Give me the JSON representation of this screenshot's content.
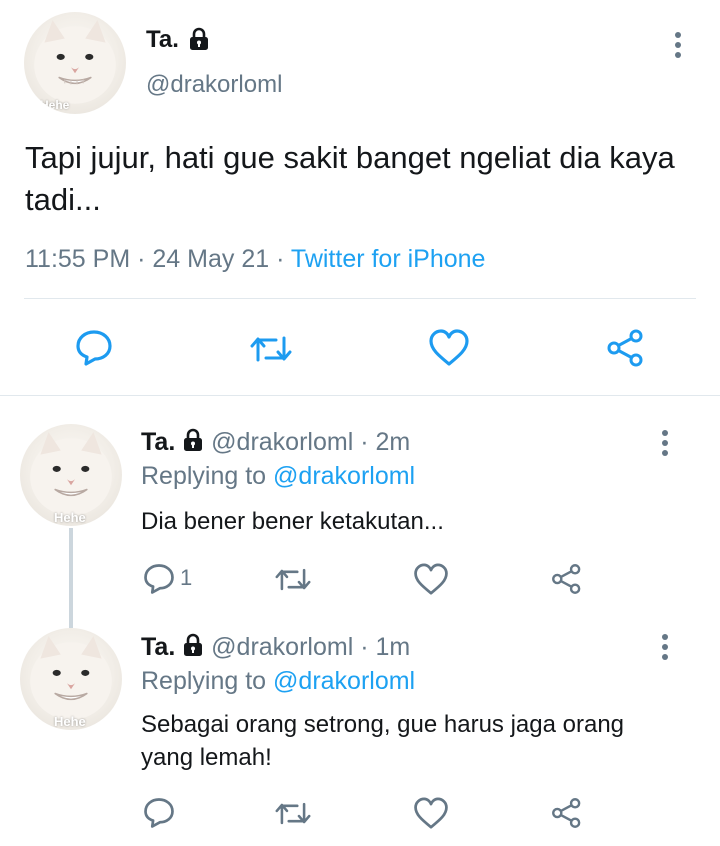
{
  "main_tweet": {
    "name": "Ta.",
    "handle": "@drakorloml",
    "text": "Tapi jujur, hati gue sakit banget ngeliat dia kaya tadi...",
    "time": "11:55 PM",
    "date": "24 May 21",
    "source": "Twitter for iPhone",
    "avatar_caption": "Hehe",
    "actions": [
      "reply-icon",
      "retweet-icon",
      "like-icon",
      "share-icon"
    ]
  },
  "replies": [
    {
      "name": "Ta.",
      "handle": "@drakorloml",
      "age": "2m",
      "replying_label": "Replying to",
      "replying_to": "@drakorloml",
      "text": "Dia bener bener ketakutan...",
      "reply_count": "1",
      "avatar_caption": "Hehe"
    },
    {
      "name": "Ta.",
      "handle": "@drakorloml",
      "age": "1m",
      "replying_label": "Replying to",
      "replying_to": "@drakorloml",
      "text": "Sebagai orang setrong, gue harus jaga orang yang lemah!",
      "reply_count": "",
      "avatar_caption": "Hehe"
    }
  ],
  "colors": {
    "accent": "#1da1f2",
    "secondary_text": "#657786",
    "divider": "#e1e8ed"
  }
}
